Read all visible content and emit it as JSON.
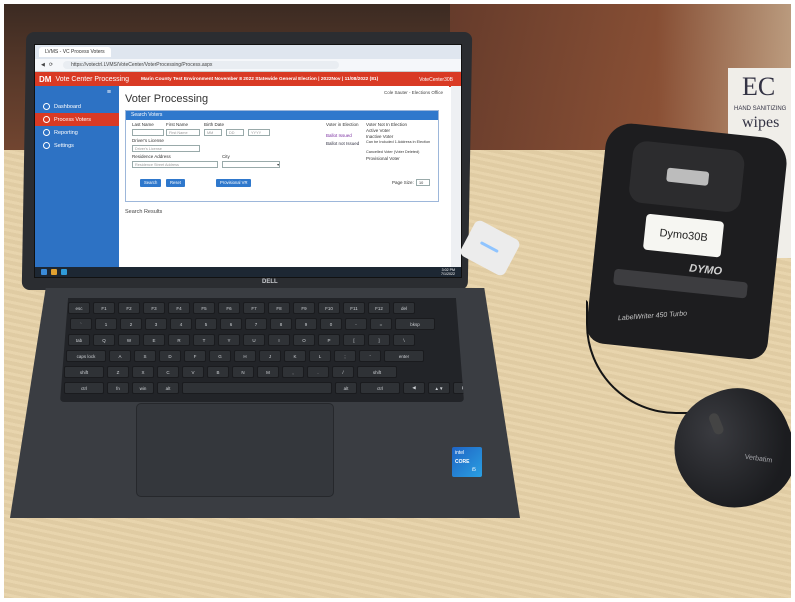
{
  "browser": {
    "tab_title": "LVMS - VC Process Voters",
    "url": "https://votectrl.LVMS/VoteCenter/VoterProcessing/Process.aspx"
  },
  "app": {
    "logo": "DM",
    "name": "Vote Center Processing",
    "election_info": "Marin County Test Environment   November 8 2022 Statewide General Election | 2022Nov | 11/08/2022 (81)",
    "station": "VoteCenter30B"
  },
  "sidebar": {
    "items": [
      {
        "label": "Dashboard"
      },
      {
        "label": "Process Voters"
      },
      {
        "label": "Reporting"
      },
      {
        "label": "Settings"
      }
    ]
  },
  "main": {
    "title": "Voter Processing",
    "user": "Cole Sauter - Elections Office",
    "panel_title": "Search Voters",
    "last_name_label": "Last Name",
    "first_name_label": "First Name",
    "first_name_placeholder": "First Name",
    "birth_date_label": "Birth Date",
    "birth_mm": "MM",
    "birth_dd": "DD",
    "birth_yyyy": "YYYY",
    "dl_label": "Driver's License",
    "dl_placeholder": "Driver's License",
    "address_label": "Residence Address",
    "address_placeholder": "Residence Street Address",
    "city_label": "City",
    "vote_in_election_label": "Voter in Election",
    "ballot_issued": "Ballot Issued",
    "ballot_not_issued": "Ballot not Issued",
    "not_in_election_label": "Voter Not In Election",
    "active_voter": "Active Voter",
    "inactive_voter": "Inactive Voter",
    "to_be_added": "Can be Included 1 Address in Election",
    "cancelled_voter": "Cancelled Voter (Voter Deleted)",
    "provisional_voter": "Provisional Voter",
    "search_button": "Search",
    "reset_button": "Reset",
    "provisional_button": "Provisional VR",
    "page_size_label": "Page Size:",
    "page_size_value": "10",
    "search_results": "Search Results"
  },
  "taskbar": {
    "time": "3:02 PM",
    "date": "7/1/2022"
  },
  "hardware": {
    "laptop_brand": "DELL",
    "intel_line1": "intel",
    "intel_line2": "CORE",
    "intel_line3": "i5",
    "printer_label": "Dymo30B",
    "printer_brand": "DYMO",
    "printer_model": "LabelWriter 450 Turbo",
    "box_line1": "EC",
    "box_line2": "HAND SANITIZING",
    "box_line3": "wipes",
    "mouse_brand": "Verbatim"
  },
  "keyboard": {
    "row1": [
      "esc",
      "F1",
      "F2",
      "F3",
      "F4",
      "F5",
      "F6",
      "F7",
      "F8",
      "F9",
      "F10",
      "F11",
      "F12",
      "del"
    ],
    "row2": [
      "`",
      "1",
      "2",
      "3",
      "4",
      "5",
      "6",
      "7",
      "8",
      "9",
      "0",
      "-",
      "=",
      "bksp"
    ],
    "row3": [
      "tab",
      "Q",
      "W",
      "E",
      "R",
      "T",
      "Y",
      "U",
      "I",
      "O",
      "P",
      "[",
      "]",
      "\\"
    ],
    "row4": [
      "caps lock",
      "A",
      "S",
      "D",
      "F",
      "G",
      "H",
      "J",
      "K",
      "L",
      ";",
      "'",
      "enter"
    ],
    "row5": [
      "shift",
      "Z",
      "X",
      "C",
      "V",
      "B",
      "N",
      "M",
      ",",
      ".",
      "/",
      "shift"
    ],
    "row6": [
      "ctrl",
      "fn",
      "win",
      "alt",
      "",
      "alt",
      "ctrl",
      "◀",
      "▲▼",
      "▶"
    ]
  }
}
